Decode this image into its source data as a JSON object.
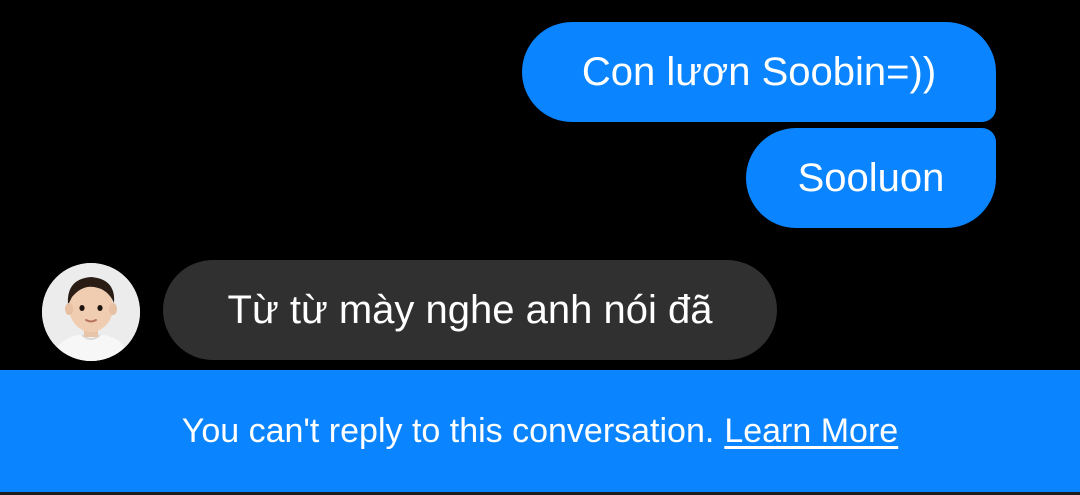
{
  "conversation": {
    "messages": [
      {
        "sender": "me",
        "text": "Con lươn Soobin=))"
      },
      {
        "sender": "me",
        "text": "Sooluon"
      },
      {
        "sender": "other",
        "text": "Từ từ mày nghe anh nói đã"
      }
    ]
  },
  "footer": {
    "notice": "You can't reply to this conversation.",
    "link_label": "Learn More"
  },
  "colors": {
    "background": "#000000",
    "sent_bubble": "#0a84ff",
    "received_bubble": "#303030",
    "footer": "#0a84ff",
    "text": "#ffffff"
  },
  "icons": {
    "avatar": "contact-avatar-photo"
  }
}
